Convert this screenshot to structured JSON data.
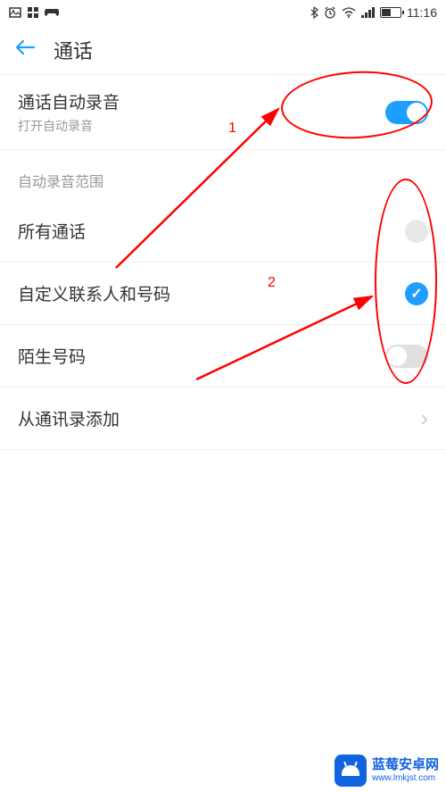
{
  "status": {
    "time": "11:16"
  },
  "header": {
    "title": "通话"
  },
  "settings": {
    "autoRecord": {
      "title": "通话自动录音",
      "subtitle": "打开自动录音",
      "enabled": true
    },
    "scopeLabel": "自动录音范围",
    "allCalls": {
      "label": "所有通话",
      "selected": false
    },
    "customContacts": {
      "label": "自定义联系人和号码",
      "selected": true
    },
    "unknownNumbers": {
      "label": "陌生号码",
      "enabled": false
    },
    "addFromContacts": {
      "label": "从通讯录添加"
    }
  },
  "annotations": {
    "label1": "1",
    "label2": "2"
  },
  "watermark": {
    "name": "蓝莓安卓网",
    "url": "www.lmkjst.com"
  }
}
